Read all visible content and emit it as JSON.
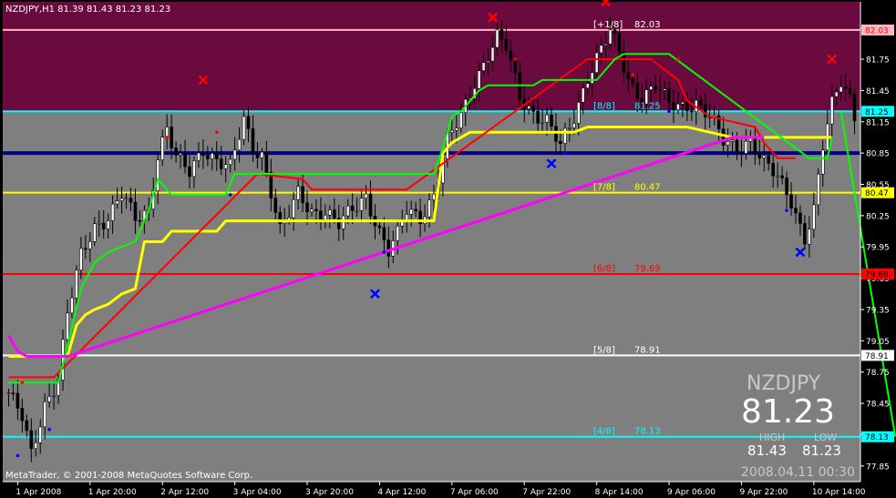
{
  "window": {
    "title": "NZDJPY,H1 81.39 81.43 81.23 81.23",
    "copyright": "MetaTrader, © 2001-2008 MetaQuotes Software Corp."
  },
  "colors": {
    "background": "#000000",
    "plot_area": "#7f7f7f",
    "upper_zone": "#6b0a3f",
    "candle": "#000000",
    "text": "#ffffff",
    "grid_text": "#ffffff",
    "green_line": "#00ff00",
    "yellow_line": "#ffff00",
    "red_line": "#ff0000",
    "magenta_line": "#ff00ff",
    "blue_line": "#000080",
    "fractal_up": "#ff0000",
    "fractal_down": "#0000ff"
  },
  "info_panel": {
    "symbol": "NZDJPY",
    "last_price": "81.23",
    "high_label": "HIGH",
    "low_label": "LOW",
    "high_value": "81.43",
    "low_value": "81.23",
    "datetime": "2008.04.11 00:30"
  },
  "chart_data": {
    "type": "candlestick",
    "symbol": "NZDJPY",
    "timeframe": "H1",
    "ylim": [
      77.7,
      82.3
    ],
    "y_ticks": [
      "82.05",
      "81.75",
      "81.45",
      "81.15",
      "80.85",
      "80.55",
      "80.25",
      "79.95",
      "79.65",
      "79.35",
      "79.05",
      "78.75",
      "78.45",
      "78.15",
      "77.85"
    ],
    "x_ticks": [
      {
        "label": "1 Apr 2008",
        "bar": 2
      },
      {
        "label": "1 Apr 20:00",
        "bar": 18
      },
      {
        "label": "2 Apr 12:00",
        "bar": 34
      },
      {
        "label": "3 Apr 04:00",
        "bar": 50
      },
      {
        "label": "3 Apr 20:00",
        "bar": 66
      },
      {
        "label": "4 Apr 12:00",
        "bar": 82
      },
      {
        "label": "7 Apr 06:00",
        "bar": 98
      },
      {
        "label": "7 Apr 22:00",
        "bar": 114
      },
      {
        "label": "8 Apr 14:00",
        "bar": 130
      },
      {
        "label": "9 Apr 06:00",
        "bar": 146
      },
      {
        "label": "9 Apr 22:00",
        "bar": 162
      },
      {
        "label": "10 Apr 14:00",
        "bar": 178
      }
    ],
    "x_tick_values": [
      "1 Apr 2008",
      "1 Apr 20:00",
      "2 Apr 12:00",
      "3 Apr 04:00",
      "3 Apr 20:00",
      "4 Apr 12:00",
      "7 Apr 06:00",
      "7 Apr 22:00",
      "8 Apr 14:00",
      "9 Apr 06:00",
      "9 Apr 22:00",
      "10 Apr 14:00"
    ],
    "bar_count": 188,
    "close_anchors": [
      [
        0,
        78.55
      ],
      [
        3,
        78.3
      ],
      [
        5,
        77.95
      ],
      [
        8,
        78.45
      ],
      [
        11,
        78.7
      ],
      [
        13,
        79.3
      ],
      [
        16,
        79.85
      ],
      [
        19,
        80.15
      ],
      [
        22,
        80.25
      ],
      [
        25,
        80.45
      ],
      [
        28,
        80.2
      ],
      [
        31,
        80.3
      ],
      [
        33,
        80.85
      ],
      [
        35,
        81.1
      ],
      [
        37,
        80.8
      ],
      [
        40,
        80.65
      ],
      [
        43,
        80.9
      ],
      [
        46,
        80.8
      ],
      [
        49,
        80.7
      ],
      [
        52,
        81.15
      ],
      [
        54,
        80.9
      ],
      [
        56,
        80.85
      ],
      [
        58,
        80.5
      ],
      [
        60,
        80.1
      ],
      [
        62,
        80.25
      ],
      [
        64,
        80.45
      ],
      [
        67,
        80.3
      ],
      [
        70,
        80.3
      ],
      [
        73,
        80.15
      ],
      [
        76,
        80.3
      ],
      [
        79,
        80.45
      ],
      [
        82,
        80.1
      ],
      [
        84,
        79.9
      ],
      [
        86,
        80.05
      ],
      [
        88,
        80.3
      ],
      [
        91,
        80.25
      ],
      [
        94,
        80.45
      ],
      [
        97,
        80.95
      ],
      [
        100,
        81.2
      ],
      [
        103,
        81.55
      ],
      [
        106,
        81.8
      ],
      [
        108,
        81.95
      ],
      [
        110,
        81.85
      ],
      [
        113,
        81.4
      ],
      [
        116,
        81.25
      ],
      [
        119,
        81.15
      ],
      [
        122,
        80.9
      ],
      [
        125,
        81.2
      ],
      [
        128,
        81.6
      ],
      [
        131,
        81.85
      ],
      [
        133,
        82.0
      ],
      [
        135,
        81.8
      ],
      [
        137,
        81.55
      ],
      [
        140,
        81.4
      ],
      [
        143,
        81.5
      ],
      [
        146,
        81.3
      ],
      [
        149,
        81.3
      ],
      [
        152,
        81.35
      ],
      [
        155,
        81.2
      ],
      [
        158,
        80.95
      ],
      [
        161,
        80.9
      ],
      [
        164,
        81.0
      ],
      [
        167,
        80.75
      ],
      [
        170,
        80.6
      ],
      [
        173,
        80.4
      ],
      [
        176,
        80.05
      ],
      [
        178,
        80.3
      ],
      [
        180,
        80.9
      ],
      [
        182,
        81.3
      ],
      [
        184,
        81.55
      ],
      [
        186,
        81.4
      ],
      [
        187,
        81.23
      ]
    ],
    "green_line": [
      [
        0,
        78.65
      ],
      [
        11,
        78.65
      ],
      [
        13,
        79.0
      ],
      [
        16,
        79.55
      ],
      [
        19,
        79.8
      ],
      [
        22,
        79.9
      ],
      [
        25,
        79.95
      ],
      [
        28,
        80.0
      ],
      [
        31,
        80.3
      ],
      [
        33,
        80.6
      ],
      [
        36,
        80.45
      ],
      [
        48,
        80.45
      ],
      [
        50,
        80.65
      ],
      [
        60,
        80.65
      ],
      [
        94,
        80.65
      ],
      [
        96,
        80.9
      ],
      [
        98,
        81.2
      ],
      [
        100,
        81.25
      ],
      [
        102,
        81.35
      ],
      [
        104,
        81.45
      ],
      [
        106,
        81.5
      ],
      [
        116,
        81.5
      ],
      [
        118,
        81.55
      ],
      [
        130,
        81.55
      ],
      [
        132,
        81.65
      ],
      [
        134,
        81.75
      ],
      [
        136,
        81.8
      ],
      [
        146,
        81.8
      ],
      [
        177,
        80.8
      ],
      [
        181,
        80.8
      ],
      [
        182,
        81.0
      ]
    ],
    "yellow_line": [
      [
        0,
        78.9
      ],
      [
        13,
        78.9
      ],
      [
        15,
        79.2
      ],
      [
        17,
        79.3
      ],
      [
        19,
        79.35
      ],
      [
        22,
        79.4
      ],
      [
        25,
        79.5
      ],
      [
        28,
        79.55
      ],
      [
        30,
        80.0
      ],
      [
        34,
        80.0
      ],
      [
        36,
        80.1
      ],
      [
        46,
        80.1
      ],
      [
        48,
        80.2
      ],
      [
        60,
        80.2
      ],
      [
        94,
        80.2
      ],
      [
        96,
        80.85
      ],
      [
        98,
        80.95
      ],
      [
        100,
        81.0
      ],
      [
        102,
        81.05
      ],
      [
        104,
        81.05
      ],
      [
        125,
        81.05
      ],
      [
        128,
        81.1
      ],
      [
        150,
        81.1
      ],
      [
        160,
        81.0
      ],
      [
        175,
        81.0
      ],
      [
        182,
        81.0
      ]
    ],
    "red_line": [
      [
        0,
        78.7
      ],
      [
        10,
        78.7
      ],
      [
        55,
        80.65
      ],
      [
        65,
        80.6
      ],
      [
        67,
        80.5
      ],
      [
        88,
        80.5
      ],
      [
        128,
        81.75
      ],
      [
        139,
        81.75
      ],
      [
        142,
        81.75
      ],
      [
        148,
        81.55
      ],
      [
        150,
        81.35
      ],
      [
        155,
        81.2
      ],
      [
        165,
        81.1
      ],
      [
        167,
        80.95
      ],
      [
        169,
        80.85
      ],
      [
        170,
        80.8
      ],
      [
        174,
        80.8
      ]
    ],
    "magenta_line": [
      [
        0,
        79.1
      ],
      [
        2,
        78.95
      ],
      [
        4,
        78.9
      ],
      [
        13,
        78.9
      ],
      [
        160,
        81.0
      ],
      [
        167,
        81.0
      ]
    ],
    "blue_line": 80.85,
    "murrey_levels": [
      {
        "label": "[+1/8]",
        "value": "82.03",
        "price": 82.03,
        "color": "#ffb6c1",
        "axis_bg": "#ffb6c1",
        "axis_fg": "#ff0000"
      },
      {
        "label": "[8/8]",
        "value": "81.25",
        "price": 81.25,
        "color": "#00ffff",
        "axis_bg": "#00ffff",
        "axis_fg": "#000000"
      },
      {
        "label": "[7/8]",
        "value": "80.47",
        "price": 80.47,
        "color": "#ffff00",
        "axis_bg": "#ffff00",
        "axis_fg": "#000000"
      },
      {
        "label": "[6/8]",
        "value": "79.69",
        "price": 79.69,
        "color": "#ff0000",
        "axis_bg": "#ff0000",
        "axis_fg": "#000000"
      },
      {
        "label": "[5/8]",
        "value": "78.91",
        "price": 78.91,
        "color": "#ffffff",
        "axis_bg": "#ffffff",
        "axis_fg": "#000000"
      },
      {
        "label": "[4/8]",
        "value": "78.13",
        "price": 78.13,
        "color": "#00ffff",
        "axis_bg": "#00ffff",
        "axis_fg": "#000000"
      }
    ],
    "axis_price_labels": [
      "82.03",
      "81.25",
      "80.47",
      "79.69",
      "78.91",
      "78.13"
    ],
    "fractals_up": [
      [
        43,
        81.55
      ],
      [
        107,
        82.15
      ],
      [
        132,
        82.3
      ],
      [
        182,
        81.75
      ]
    ],
    "fractals_down": [
      [
        81,
        79.5
      ],
      [
        120,
        80.75
      ],
      [
        175,
        79.9
      ]
    ],
    "dots_red": [
      [
        3,
        78.65
      ],
      [
        35,
        81.0
      ],
      [
        46,
        81.05
      ],
      [
        112,
        81.75
      ],
      [
        138,
        81.6
      ],
      [
        148,
        81.75
      ]
    ],
    "dots_blue": [
      [
        2,
        77.95
      ],
      [
        9,
        78.2
      ],
      [
        49,
        80.45
      ],
      [
        83,
        79.9
      ],
      [
        123,
        80.85
      ],
      [
        146,
        81.25
      ],
      [
        172,
        80.3
      ]
    ],
    "trend_line": [
      [
        184,
        81.25
      ],
      [
        196,
        78.13
      ]
    ]
  }
}
